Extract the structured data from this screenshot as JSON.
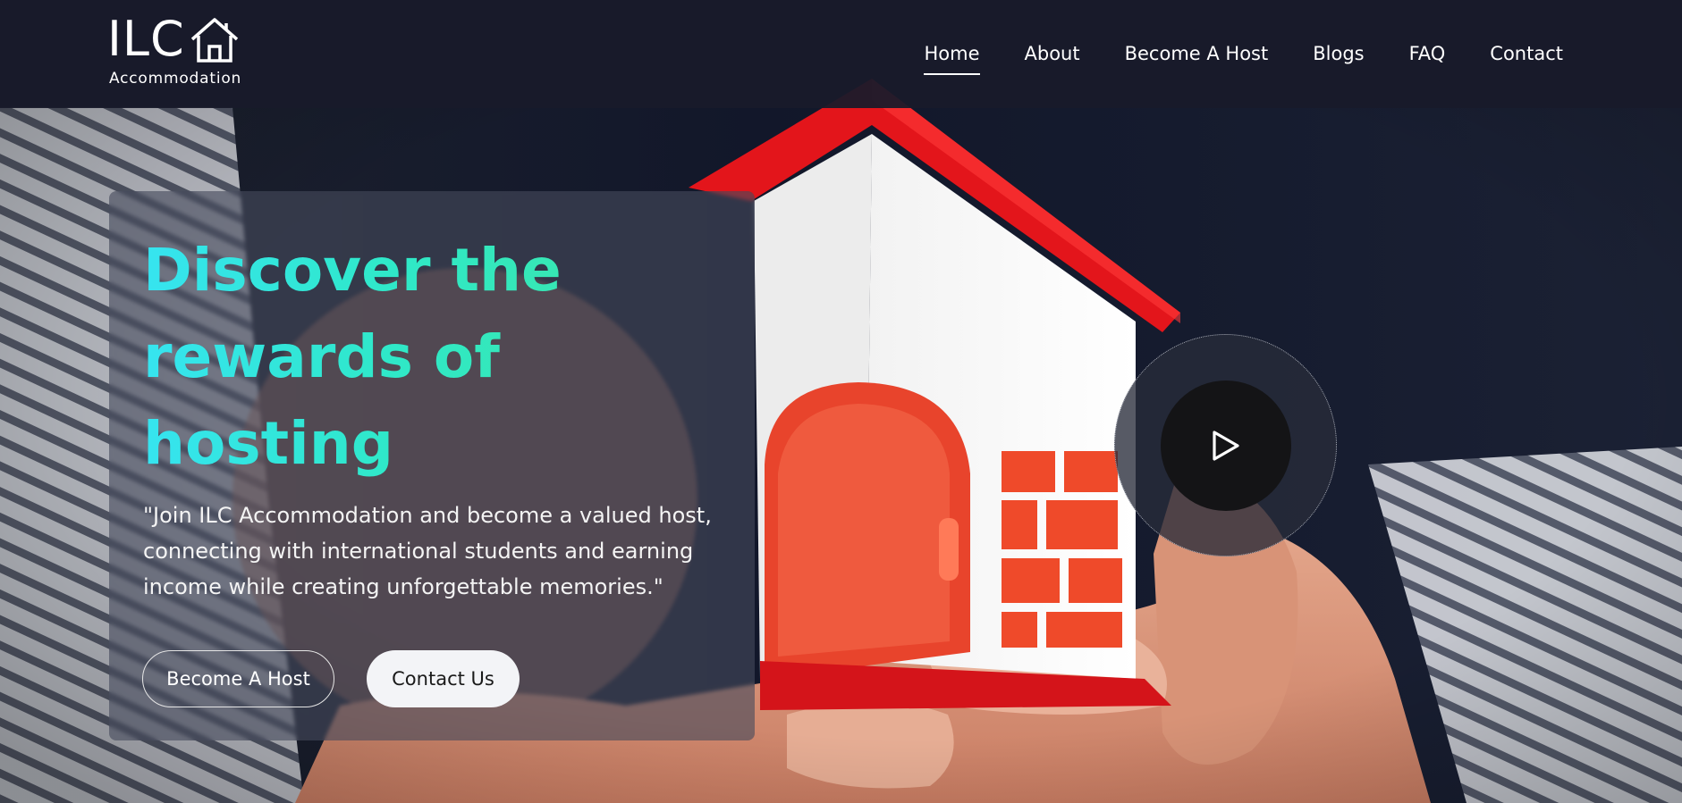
{
  "brand": {
    "name": "ILC",
    "sub": "Accommodation"
  },
  "nav": {
    "items": [
      {
        "label": "Home",
        "active": true
      },
      {
        "label": "About",
        "active": false
      },
      {
        "label": "Become A Host",
        "active": false
      },
      {
        "label": "Blogs",
        "active": false
      },
      {
        "label": "FAQ",
        "active": false
      },
      {
        "label": "Contact",
        "active": false
      }
    ]
  },
  "hero": {
    "headline": "Discover the rewards of hosting",
    "tagline": "\"Join ILC Accommodation and become a valued host, connecting with international students and earning income while creating unforgettable memories.\"",
    "primary_button": "Become A Host",
    "secondary_button": "Contact Us",
    "play_icon": "play-icon"
  },
  "colors": {
    "header_bg": "#181b2a",
    "headline_gradient_start": "#36e4f0",
    "headline_gradient_end": "#3de6a4",
    "house_roof": "#e81a1a",
    "secondary_button_bg": "#f3f4f7"
  }
}
